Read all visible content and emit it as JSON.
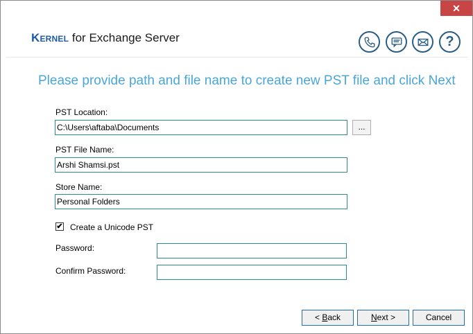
{
  "window": {
    "close_glyph": "✕"
  },
  "header": {
    "brand_kernel": "Kernel",
    "brand_rest": " for Exchange Server",
    "icons": [
      "phone-icon",
      "chat-icon",
      "mail-icon",
      "help-icon"
    ],
    "help_glyph": "?"
  },
  "main": {
    "instruction": "Please provide path and file name to create new PST file and click Next",
    "pst_location": {
      "label": "PST Location:",
      "value": "C:\\Users\\aftaba\\Documents",
      "browse_label": "..."
    },
    "pst_file_name": {
      "label": "PST File Name:",
      "value": "Arshi Shamsi.pst"
    },
    "store_name": {
      "label": "Store Name:",
      "value": "Personal Folders"
    },
    "unicode": {
      "label": "Create a Unicode PST",
      "checked_glyph": "✔"
    },
    "password": {
      "label": "Password:",
      "value": ""
    },
    "confirm_password": {
      "label": "Confirm Password:",
      "value": ""
    }
  },
  "footer": {
    "back": {
      "prefix": "< ",
      "mnemonic": "B",
      "rest": "ack"
    },
    "next": {
      "mnemonic": "N",
      "rest": "ext >"
    },
    "cancel": "Cancel"
  },
  "colors": {
    "accent": "#4aa6d6",
    "brand": "#1f5aa6",
    "icon": "#2a5d84",
    "close": "#c74545"
  }
}
